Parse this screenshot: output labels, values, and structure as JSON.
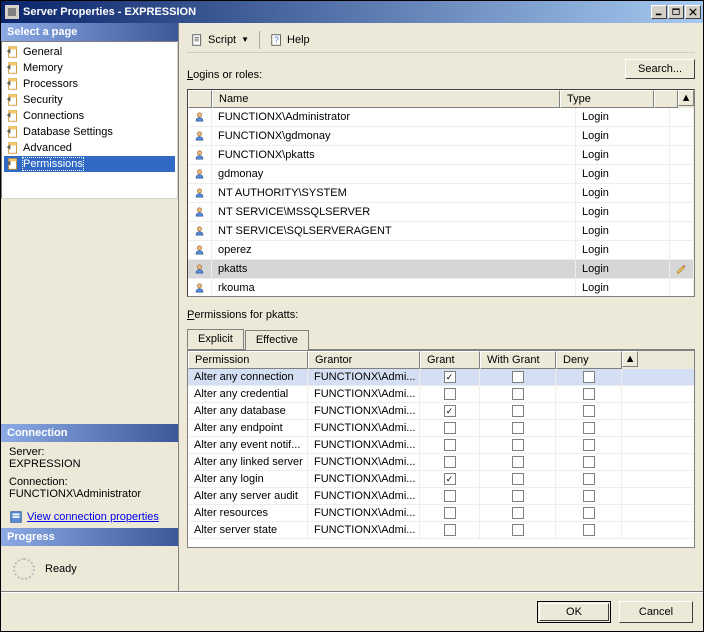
{
  "window": {
    "title": "Server Properties - EXPRESSION"
  },
  "toolbar": {
    "script_label": "Script",
    "help_label": "Help"
  },
  "left": {
    "select_page": "Select a page",
    "pages": [
      {
        "label": "General",
        "selected": false
      },
      {
        "label": "Memory",
        "selected": false
      },
      {
        "label": "Processors",
        "selected": false
      },
      {
        "label": "Security",
        "selected": false
      },
      {
        "label": "Connections",
        "selected": false
      },
      {
        "label": "Database Settings",
        "selected": false
      },
      {
        "label": "Advanced",
        "selected": false
      },
      {
        "label": "Permissions",
        "selected": true
      }
    ],
    "connection_header": "Connection",
    "server_label": "Server:",
    "server_value": "EXPRESSION",
    "conn_label": "Connection:",
    "conn_value": "FUNCTIONX\\Administrator",
    "view_conn_link": "View connection properties",
    "progress_header": "Progress",
    "progress_status": "Ready"
  },
  "main": {
    "logins_label": "Logins or roles:",
    "search_label": "Search...",
    "logins_header": {
      "name": "Name",
      "type": "Type"
    },
    "logins": [
      {
        "name": "FUNCTIONX\\Administrator",
        "type": "Login",
        "selected": false,
        "editable": false
      },
      {
        "name": "FUNCTIONX\\gdmonay",
        "type": "Login",
        "selected": false,
        "editable": false
      },
      {
        "name": "FUNCTIONX\\pkatts",
        "type": "Login",
        "selected": false,
        "editable": false
      },
      {
        "name": "gdmonay",
        "type": "Login",
        "selected": false,
        "editable": false
      },
      {
        "name": "NT AUTHORITY\\SYSTEM",
        "type": "Login",
        "selected": false,
        "editable": false
      },
      {
        "name": "NT SERVICE\\MSSQLSERVER",
        "type": "Login",
        "selected": false,
        "editable": false
      },
      {
        "name": "NT SERVICE\\SQLSERVERAGENT",
        "type": "Login",
        "selected": false,
        "editable": false
      },
      {
        "name": "operez",
        "type": "Login",
        "selected": false,
        "editable": false
      },
      {
        "name": "pkatts",
        "type": "Login",
        "selected": true,
        "editable": true
      },
      {
        "name": "rkouma",
        "type": "Login",
        "selected": false,
        "editable": false
      }
    ],
    "perms_for_label": "Permissions for pkatts:",
    "tabs": [
      {
        "label": "Explicit",
        "active": true
      },
      {
        "label": "Effective",
        "active": false
      }
    ],
    "perm_header": {
      "perm": "Permission",
      "grantor": "Grantor",
      "grant": "Grant",
      "wgrant": "With Grant",
      "deny": "Deny"
    },
    "perms": [
      {
        "perm": "Alter any connection",
        "grantor": "FUNCTIONX\\Admi...",
        "grant": true,
        "wgrant": false,
        "deny": false,
        "sel": true
      },
      {
        "perm": "Alter any credential",
        "grantor": "FUNCTIONX\\Admi...",
        "grant": false,
        "wgrant": false,
        "deny": false,
        "sel": false
      },
      {
        "perm": "Alter any database",
        "grantor": "FUNCTIONX\\Admi...",
        "grant": true,
        "wgrant": false,
        "deny": false,
        "sel": false
      },
      {
        "perm": "Alter any endpoint",
        "grantor": "FUNCTIONX\\Admi...",
        "grant": false,
        "wgrant": false,
        "deny": false,
        "sel": false
      },
      {
        "perm": "Alter any event notif...",
        "grantor": "FUNCTIONX\\Admi...",
        "grant": false,
        "wgrant": false,
        "deny": false,
        "sel": false
      },
      {
        "perm": "Alter any linked server",
        "grantor": "FUNCTIONX\\Admi...",
        "grant": false,
        "wgrant": false,
        "deny": false,
        "sel": false
      },
      {
        "perm": "Alter any login",
        "grantor": "FUNCTIONX\\Admi...",
        "grant": true,
        "wgrant": false,
        "deny": false,
        "sel": false
      },
      {
        "perm": "Alter any server audit",
        "grantor": "FUNCTIONX\\Admi...",
        "grant": false,
        "wgrant": false,
        "deny": false,
        "sel": false
      },
      {
        "perm": "Alter resources",
        "grantor": "FUNCTIONX\\Admi...",
        "grant": false,
        "wgrant": false,
        "deny": false,
        "sel": false
      },
      {
        "perm": "Alter server state",
        "grantor": "FUNCTIONX\\Admi...",
        "grant": false,
        "wgrant": false,
        "deny": false,
        "sel": false
      }
    ]
  },
  "buttons": {
    "ok": "OK",
    "cancel": "Cancel"
  }
}
